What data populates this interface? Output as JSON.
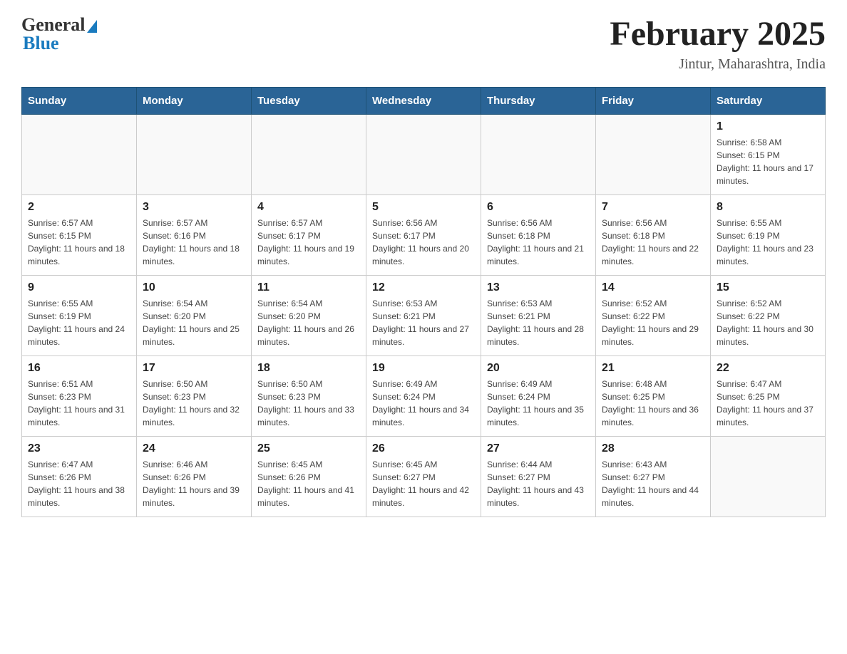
{
  "header": {
    "logo_general": "General",
    "logo_blue": "Blue",
    "title": "February 2025",
    "location": "Jintur, Maharashtra, India"
  },
  "days_of_week": [
    "Sunday",
    "Monday",
    "Tuesday",
    "Wednesday",
    "Thursday",
    "Friday",
    "Saturday"
  ],
  "weeks": [
    [
      {
        "day": "",
        "info": ""
      },
      {
        "day": "",
        "info": ""
      },
      {
        "day": "",
        "info": ""
      },
      {
        "day": "",
        "info": ""
      },
      {
        "day": "",
        "info": ""
      },
      {
        "day": "",
        "info": ""
      },
      {
        "day": "1",
        "info": "Sunrise: 6:58 AM\nSunset: 6:15 PM\nDaylight: 11 hours and 17 minutes."
      }
    ],
    [
      {
        "day": "2",
        "info": "Sunrise: 6:57 AM\nSunset: 6:15 PM\nDaylight: 11 hours and 18 minutes."
      },
      {
        "day": "3",
        "info": "Sunrise: 6:57 AM\nSunset: 6:16 PM\nDaylight: 11 hours and 18 minutes."
      },
      {
        "day": "4",
        "info": "Sunrise: 6:57 AM\nSunset: 6:17 PM\nDaylight: 11 hours and 19 minutes."
      },
      {
        "day": "5",
        "info": "Sunrise: 6:56 AM\nSunset: 6:17 PM\nDaylight: 11 hours and 20 minutes."
      },
      {
        "day": "6",
        "info": "Sunrise: 6:56 AM\nSunset: 6:18 PM\nDaylight: 11 hours and 21 minutes."
      },
      {
        "day": "7",
        "info": "Sunrise: 6:56 AM\nSunset: 6:18 PM\nDaylight: 11 hours and 22 minutes."
      },
      {
        "day": "8",
        "info": "Sunrise: 6:55 AM\nSunset: 6:19 PM\nDaylight: 11 hours and 23 minutes."
      }
    ],
    [
      {
        "day": "9",
        "info": "Sunrise: 6:55 AM\nSunset: 6:19 PM\nDaylight: 11 hours and 24 minutes."
      },
      {
        "day": "10",
        "info": "Sunrise: 6:54 AM\nSunset: 6:20 PM\nDaylight: 11 hours and 25 minutes."
      },
      {
        "day": "11",
        "info": "Sunrise: 6:54 AM\nSunset: 6:20 PM\nDaylight: 11 hours and 26 minutes."
      },
      {
        "day": "12",
        "info": "Sunrise: 6:53 AM\nSunset: 6:21 PM\nDaylight: 11 hours and 27 minutes."
      },
      {
        "day": "13",
        "info": "Sunrise: 6:53 AM\nSunset: 6:21 PM\nDaylight: 11 hours and 28 minutes."
      },
      {
        "day": "14",
        "info": "Sunrise: 6:52 AM\nSunset: 6:22 PM\nDaylight: 11 hours and 29 minutes."
      },
      {
        "day": "15",
        "info": "Sunrise: 6:52 AM\nSunset: 6:22 PM\nDaylight: 11 hours and 30 minutes."
      }
    ],
    [
      {
        "day": "16",
        "info": "Sunrise: 6:51 AM\nSunset: 6:23 PM\nDaylight: 11 hours and 31 minutes."
      },
      {
        "day": "17",
        "info": "Sunrise: 6:50 AM\nSunset: 6:23 PM\nDaylight: 11 hours and 32 minutes."
      },
      {
        "day": "18",
        "info": "Sunrise: 6:50 AM\nSunset: 6:23 PM\nDaylight: 11 hours and 33 minutes."
      },
      {
        "day": "19",
        "info": "Sunrise: 6:49 AM\nSunset: 6:24 PM\nDaylight: 11 hours and 34 minutes."
      },
      {
        "day": "20",
        "info": "Sunrise: 6:49 AM\nSunset: 6:24 PM\nDaylight: 11 hours and 35 minutes."
      },
      {
        "day": "21",
        "info": "Sunrise: 6:48 AM\nSunset: 6:25 PM\nDaylight: 11 hours and 36 minutes."
      },
      {
        "day": "22",
        "info": "Sunrise: 6:47 AM\nSunset: 6:25 PM\nDaylight: 11 hours and 37 minutes."
      }
    ],
    [
      {
        "day": "23",
        "info": "Sunrise: 6:47 AM\nSunset: 6:26 PM\nDaylight: 11 hours and 38 minutes."
      },
      {
        "day": "24",
        "info": "Sunrise: 6:46 AM\nSunset: 6:26 PM\nDaylight: 11 hours and 39 minutes."
      },
      {
        "day": "25",
        "info": "Sunrise: 6:45 AM\nSunset: 6:26 PM\nDaylight: 11 hours and 41 minutes."
      },
      {
        "day": "26",
        "info": "Sunrise: 6:45 AM\nSunset: 6:27 PM\nDaylight: 11 hours and 42 minutes."
      },
      {
        "day": "27",
        "info": "Sunrise: 6:44 AM\nSunset: 6:27 PM\nDaylight: 11 hours and 43 minutes."
      },
      {
        "day": "28",
        "info": "Sunrise: 6:43 AM\nSunset: 6:27 PM\nDaylight: 11 hours and 44 minutes."
      },
      {
        "day": "",
        "info": ""
      }
    ]
  ]
}
